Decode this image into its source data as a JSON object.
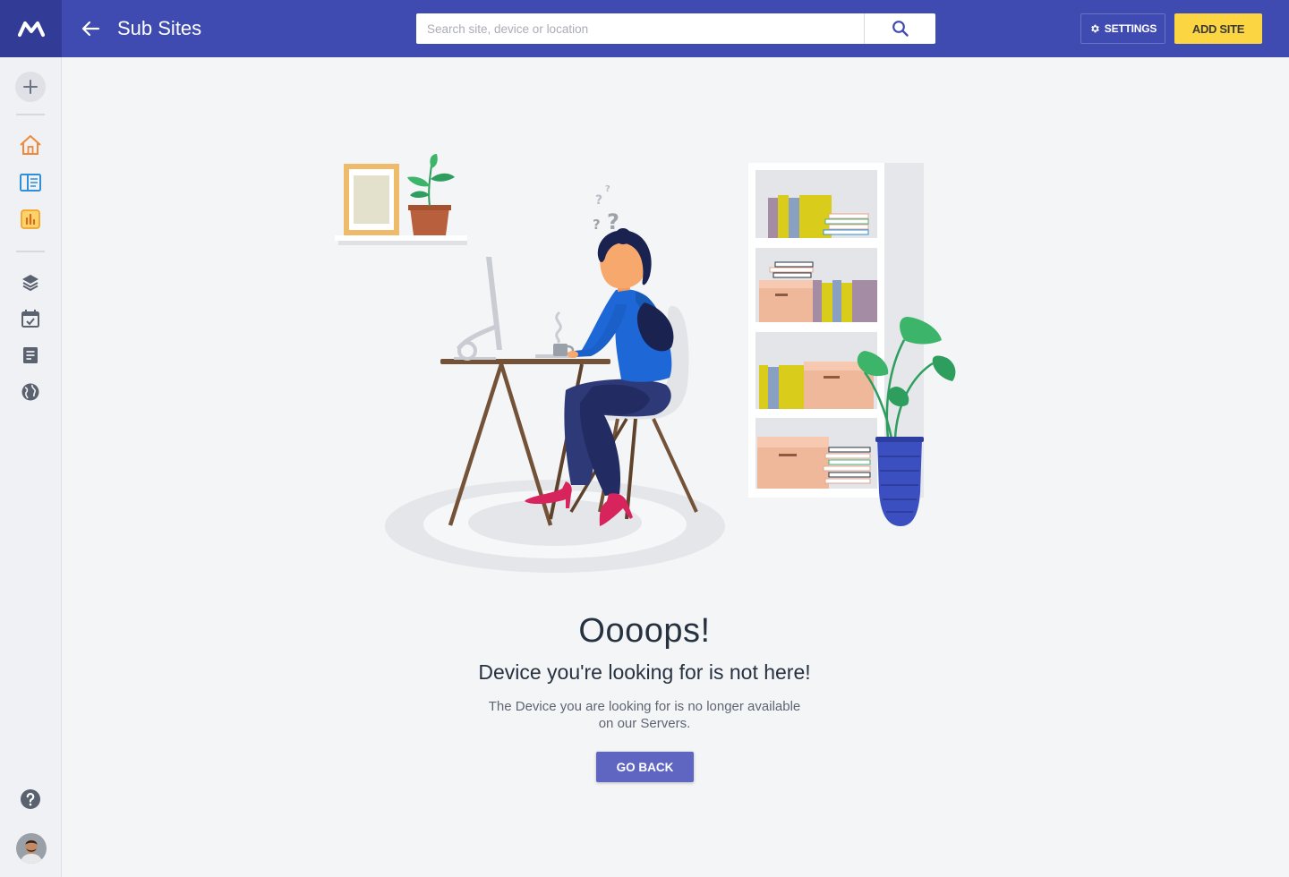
{
  "header": {
    "title": "Sub Sites",
    "search_placeholder": "Search site, device or location",
    "search_value": "",
    "settings_label": "SETTINGS",
    "add_site_label": "ADD SITE"
  },
  "sidebar": {
    "top_items": [
      {
        "icon": "plus-icon"
      },
      {
        "icon": "home-icon"
      },
      {
        "icon": "device-list-icon"
      },
      {
        "icon": "bar-chart-icon"
      }
    ],
    "nav_items": [
      {
        "icon": "layers-icon"
      },
      {
        "icon": "calendar-check-icon"
      },
      {
        "icon": "document-icon"
      },
      {
        "icon": "globe-icon"
      }
    ],
    "bottom_items": [
      {
        "icon": "help-icon"
      },
      {
        "icon": "avatar"
      }
    ]
  },
  "main": {
    "heading": "Oooops!",
    "subheading": "Device you're looking for is not here!",
    "description": "The Device you are looking for is no longer available on our Servers.",
    "button_label": "GO BACK"
  },
  "colors": {
    "topbar": "#3f4bb0",
    "accent_yellow": "#fcd542",
    "button_primary": "#5f66c2"
  }
}
